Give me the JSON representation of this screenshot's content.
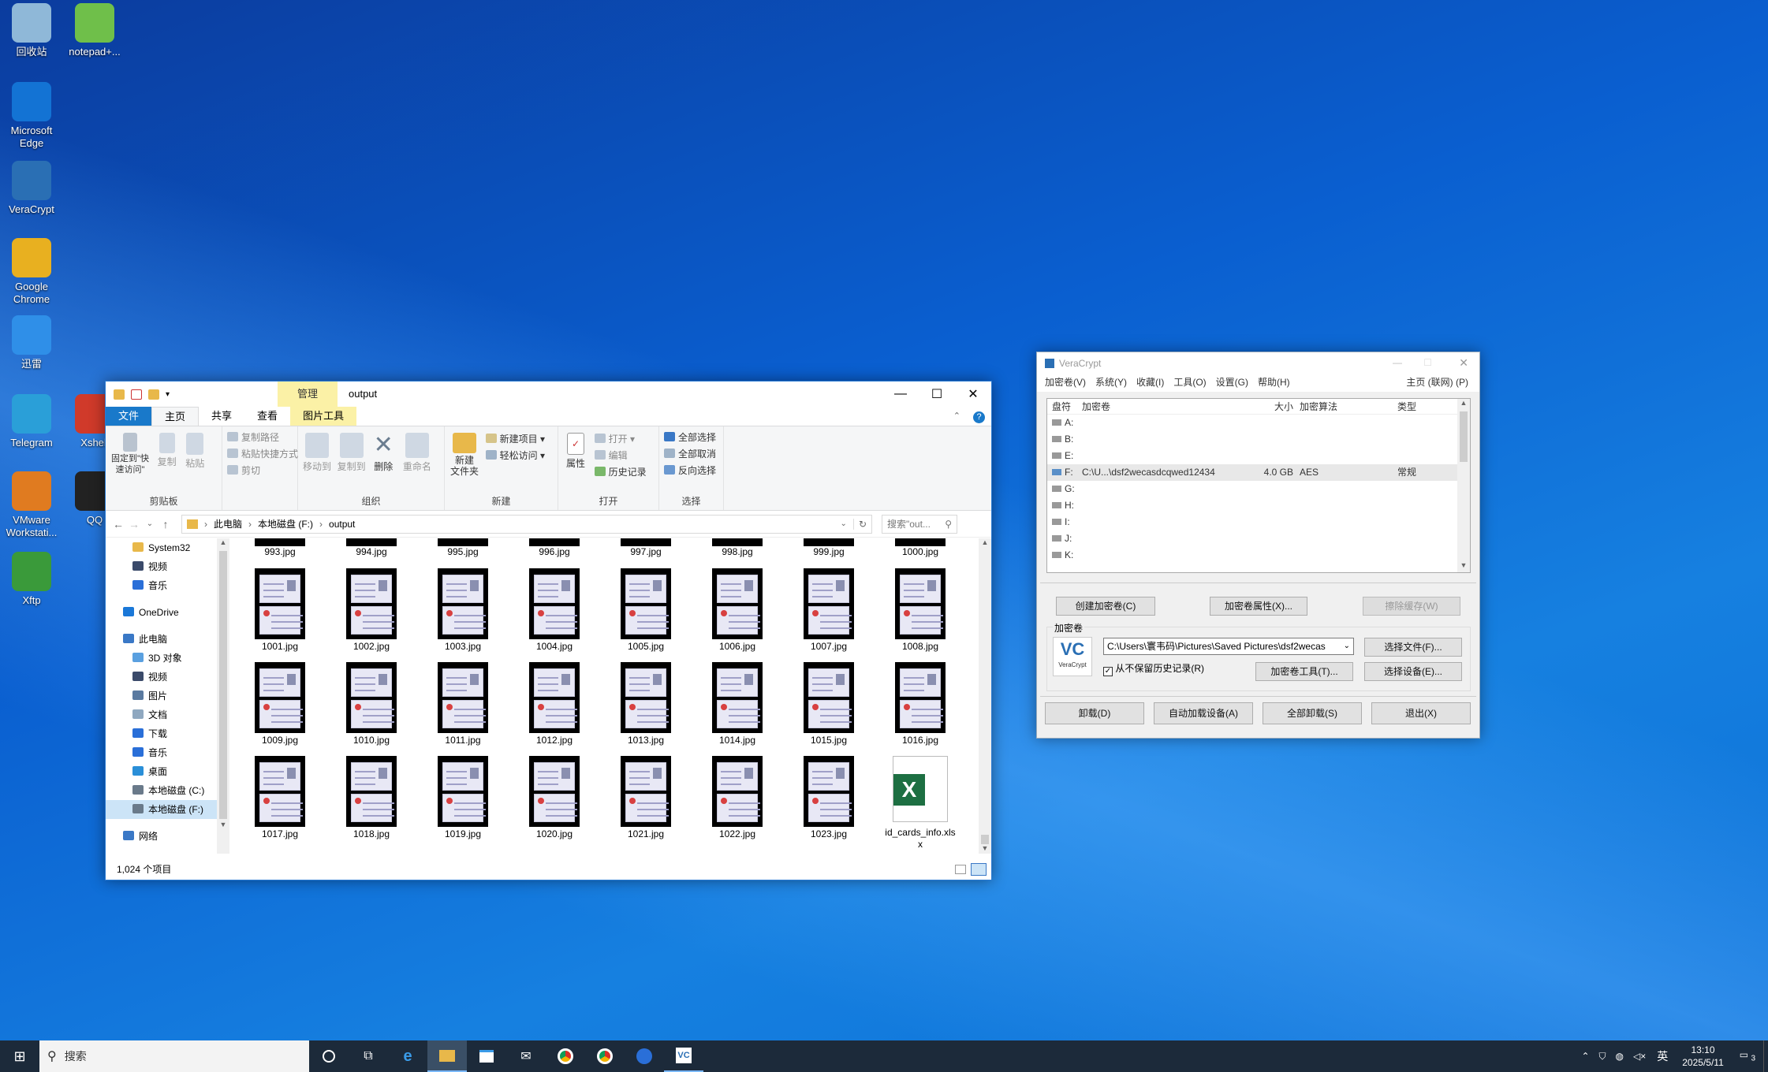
{
  "desktop": {
    "icons": [
      {
        "label": "回收站",
        "icon": "recycle-bin-icon",
        "color": "#8fb8d8"
      },
      {
        "label": "notepad+...",
        "icon": "notepad-plus-icon",
        "color": "#6fbf4a"
      },
      {
        "label": "Microsoft Edge",
        "icon": "edge-icon",
        "color": "#1373d4"
      },
      {
        "label": "VeraCrypt",
        "icon": "veracrypt-icon",
        "color": "#2a6fb4"
      },
      {
        "label": "Google Chrome",
        "icon": "chrome-icon",
        "color": "#e8b020"
      },
      {
        "label": "迅雷",
        "icon": "thunder-icon",
        "color": "#2f8fe8"
      },
      {
        "label": "Telegram",
        "icon": "telegram-icon",
        "color": "#2a9fd8"
      },
      {
        "label": "Xshell",
        "icon": "xshell-icon",
        "color": "#d03a2a"
      },
      {
        "label": "VMware Workstati...",
        "icon": "vmware-icon",
        "color": "#e07b20"
      },
      {
        "label": "QQ",
        "icon": "qq-icon",
        "color": "#222222"
      },
      {
        "label": "Xftp",
        "icon": "xftp-icon",
        "color": "#3a9a3a"
      }
    ]
  },
  "explorer": {
    "context_tab": "管理",
    "title": "output",
    "tabs": {
      "file": "文件",
      "home": "主页",
      "share": "共享",
      "view": "查看",
      "picture_tools": "图片工具"
    },
    "ribbon": {
      "clipboard": {
        "pin": "固定到\"快速访问\"",
        "copy": "复制",
        "paste": "粘贴",
        "copy_path": "复制路径",
        "paste_shortcut": "粘贴快捷方式",
        "cut": "剪切",
        "group": "剪贴板"
      },
      "organize": {
        "move_to": "移动到",
        "copy_to": "复制到",
        "delete": "删除",
        "rename": "重命名",
        "group": "组织"
      },
      "new": {
        "new_folder": "新建\n文件夹",
        "new_item": "新建项目 ▾",
        "easy_access": "轻松访问 ▾",
        "group": "新建"
      },
      "open": {
        "properties": "属性",
        "open": "打开 ▾",
        "edit": "编辑",
        "history": "历史记录",
        "group": "打开"
      },
      "select": {
        "select_all": "全部选择",
        "select_none": "全部取消",
        "invert": "反向选择",
        "group": "选择"
      }
    },
    "address": {
      "crumbs": [
        "此电脑",
        "本地磁盘 (F:)",
        "output"
      ],
      "search_placeholder": "搜索\"out..."
    },
    "nav": [
      {
        "label": "System32",
        "icon": "folder-icon",
        "indent": 1
      },
      {
        "label": "视频",
        "icon": "video-icon",
        "indent": 1
      },
      {
        "label": "音乐",
        "icon": "music-icon",
        "indent": 1
      },
      {
        "label": "OneDrive",
        "icon": "onedrive-icon",
        "indent": 0
      },
      {
        "label": "此电脑",
        "icon": "pc-icon",
        "indent": 0
      },
      {
        "label": "3D 对象",
        "icon": "3d-objects-icon",
        "indent": 1
      },
      {
        "label": "视频",
        "icon": "video-icon",
        "indent": 1
      },
      {
        "label": "图片",
        "icon": "pictures-icon",
        "indent": 1
      },
      {
        "label": "文档",
        "icon": "documents-icon",
        "indent": 1
      },
      {
        "label": "下载",
        "icon": "downloads-icon",
        "indent": 1
      },
      {
        "label": "音乐",
        "icon": "music-icon",
        "indent": 1
      },
      {
        "label": "桌面",
        "icon": "desktop-icon",
        "indent": 1
      },
      {
        "label": "本地磁盘 (C:)",
        "icon": "drive-icon",
        "indent": 1
      },
      {
        "label": "本地磁盘 (F:)",
        "icon": "drive-icon",
        "indent": 1,
        "selected": true
      },
      {
        "label": "网络",
        "icon": "network-icon",
        "indent": 0
      }
    ],
    "top_row": [
      "993.jpg",
      "994.jpg",
      "995.jpg",
      "996.jpg",
      "997.jpg",
      "998.jpg",
      "999.jpg",
      "1000.jpg"
    ],
    "grid": [
      [
        "1001.jpg",
        "1002.jpg",
        "1003.jpg",
        "1004.jpg",
        "1005.jpg",
        "1006.jpg",
        "1007.jpg",
        "1008.jpg"
      ],
      [
        "1009.jpg",
        "1010.jpg",
        "1011.jpg",
        "1012.jpg",
        "1013.jpg",
        "1014.jpg",
        "1015.jpg",
        "1016.jpg"
      ],
      [
        "1017.jpg",
        "1018.jpg",
        "1019.jpg",
        "1020.jpg",
        "1021.jpg",
        "1022.jpg",
        "1023.jpg"
      ]
    ],
    "excel_file": "id_cards_info.xlsx",
    "status": "1,024 个项目"
  },
  "veracrypt": {
    "title": "VeraCrypt",
    "menu": [
      "加密卷(V)",
      "系统(Y)",
      "收藏(I)",
      "工具(O)",
      "设置(G)",
      "帮助(H)"
    ],
    "menu_right": "主页 (联网) (P)",
    "columns": [
      "盘符",
      "加密卷",
      "大小",
      "加密算法",
      "类型"
    ],
    "drives": [
      {
        "letter": "A:"
      },
      {
        "letter": "B:"
      },
      {
        "letter": "E:"
      },
      {
        "letter": "F:",
        "volume": "C:\\U...\\dsf2wecasdcqwed12434",
        "size": "4.0 GB",
        "algo": "AES",
        "type": "常规"
      },
      {
        "letter": "G:"
      },
      {
        "letter": "H:"
      },
      {
        "letter": "I:"
      },
      {
        "letter": "J:"
      },
      {
        "letter": "K:"
      }
    ],
    "buttons": {
      "create": "创建加密卷(C)",
      "props": "加密卷属性(X)...",
      "wipe": "擦除缓存(W)",
      "select_file": "选择文件(F)...",
      "tools": "加密卷工具(T)...",
      "select_device": "选择设备(E)...",
      "dismount": "卸载(D)",
      "auto_mount": "自动加载设备(A)",
      "dismount_all": "全部卸载(S)",
      "exit": "退出(X)"
    },
    "volume_label": "加密卷",
    "volume_path": "C:\\Users\\寰韦码\\Pictures\\Saved Pictures\\dsf2wecas",
    "no_history": "从不保留历史记录(R)",
    "logo_text": "VeraCrypt"
  },
  "taskbar": {
    "search_placeholder": "搜索",
    "lang": "英",
    "time": "13:10",
    "date": "2025/5/11",
    "notif_count": "3"
  }
}
